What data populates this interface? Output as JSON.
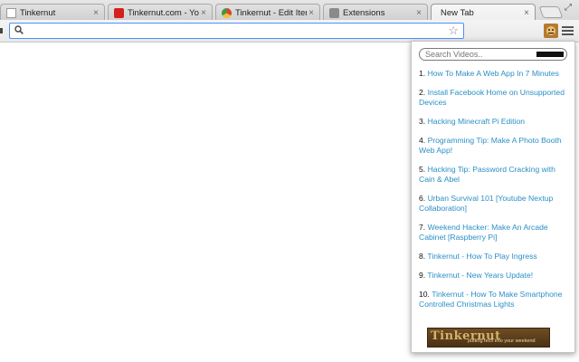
{
  "tabs": [
    {
      "title": "Tinkernut",
      "favicon": "document-icon",
      "active": false
    },
    {
      "title": "Tinkernut.com - YouTu",
      "favicon": "youtube-icon",
      "active": false
    },
    {
      "title": "Tinkernut - Edit Item",
      "favicon": "chrome-icon",
      "active": false
    },
    {
      "title": "Extensions",
      "favicon": "puzzle-icon",
      "active": false
    },
    {
      "title": "New Tab",
      "favicon": "none",
      "active": true
    }
  ],
  "toolbar": {
    "omnibox_value": "",
    "omnibox_placeholder": "",
    "accent_color": "#4d90fe"
  },
  "popup": {
    "search_placeholder": "Search Videos..",
    "link_color": "#2a8fc6",
    "videos": [
      {
        "num": "1.",
        "title": "How To Make A Web App In 7 Minutes"
      },
      {
        "num": "2.",
        "title": "Install Facebook Home on Unsupported Devices"
      },
      {
        "num": "3.",
        "title": "Hacking Minecraft Pi Edition"
      },
      {
        "num": "4.",
        "title": "Programming Tip: Make A Photo Booth Web App!"
      },
      {
        "num": "5.",
        "title": "Hacking Tip: Password Cracking with Cain & Abel"
      },
      {
        "num": "6.",
        "title": "Urban Survival 101 [Youtube Nextup Collaboration]"
      },
      {
        "num": "7.",
        "title": "Weekend Hacker: Make An Arcade Cabinet [Raspberry Pi]"
      },
      {
        "num": "8.",
        "title": "Tinkernut - How To Play Ingress"
      },
      {
        "num": "9.",
        "title": "Tinkernut - New Years Update!"
      },
      {
        "num": "10.",
        "title": "Tinkernut - How To Make Smartphone Controlled Christmas Lights"
      }
    ],
    "banner": {
      "brand": "Tinkernut",
      "tagline": "putting tech into your weekend"
    }
  }
}
